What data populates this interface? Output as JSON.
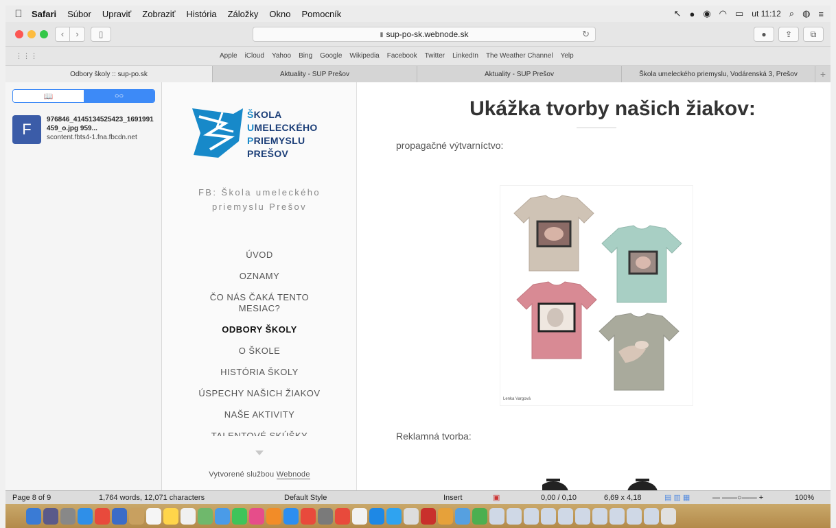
{
  "menubar": {
    "items": [
      "Safari",
      "Súbor",
      "Upraviť",
      "Zobraziť",
      "História",
      "Záložky",
      "Okno",
      "Pomocník"
    ],
    "clock": "ut 11:12"
  },
  "toolbar": {
    "url": "sup-po-sk.webnode.sk"
  },
  "bookmarks": [
    "Apple",
    "iCloud",
    "Yahoo",
    "Bing",
    "Google",
    "Wikipedia",
    "Facebook",
    "Twitter",
    "LinkedIn",
    "The Weather Channel",
    "Yelp"
  ],
  "tabs": [
    "Odbory školy :: sup-po.sk",
    "Aktuality - SUP Prešov",
    "Aktuality - SUP Prešov",
    "Škola umeleckého priemyslu, Vodárenská 3, Prešov"
  ],
  "sidebar": {
    "reading_list": {
      "favicon_letter": "F",
      "title": "976846_4145134525423_1691991459_o.jpg 959...",
      "url": "scontent.fbts4-1.fna.fbcdn.net"
    }
  },
  "site": {
    "logo_lines": [
      {
        "cap": "Š",
        "rest": "KOLA"
      },
      {
        "cap": "U",
        "rest": "MELECKÉHO"
      },
      {
        "cap": "P",
        "rest": "RIEMYSLU"
      },
      {
        "cap": "",
        "rest": "PREŠOV"
      }
    ],
    "fb_text": "FB: Škola umeleckého priemyslu Prešov",
    "menu": [
      "ÚVOD",
      "OZNAMY",
      "ČO NÁS ČAKÁ TENTO MESIAC?",
      "ODBORY ŠKOLY",
      "O ŠKOLE",
      "HISTÓRIA ŠKOLY",
      "ÚSPECHY NAŠICH ŽIAKOV",
      "NAŠE AKTIVITY",
      "TALENTOVÉ SKÚŠKY"
    ],
    "menu_active_index": 3,
    "footer_prefix": "Vytvorené službou",
    "footer_link": "Webnode"
  },
  "content": {
    "title": "Ukážka tvorby našich žiakov:",
    "section1": "propagačné výtvarníctvo:",
    "image_caption": "Lenka Vargová",
    "section2": "Reklamná tvorba:"
  },
  "statusbar": {
    "page": "Page 8 of 9",
    "words": "1,764 words, 12,071 characters",
    "style": "Default Style",
    "mode": "Insert",
    "position": "0,00 / 0,10",
    "size": "6,69 x 4,18",
    "zoom": "100%"
  },
  "colors": {
    "logo_dark": "#1a3d77",
    "logo_accent": "#1789c9",
    "accent_blue": "#3d8af7",
    "favicon_blue": "#3b5ca8"
  }
}
